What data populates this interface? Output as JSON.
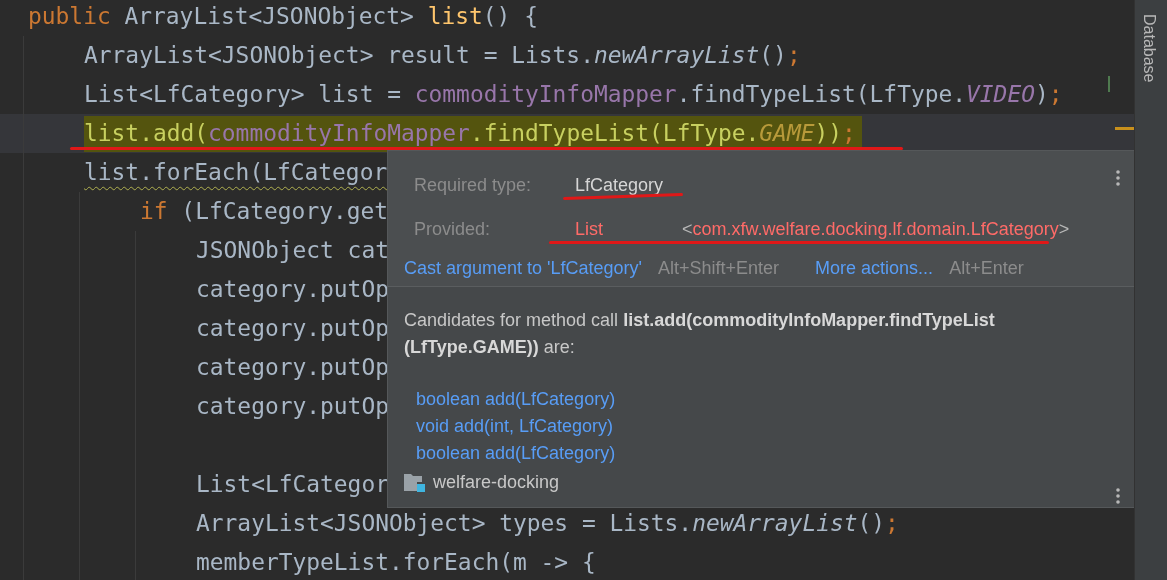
{
  "editor": {
    "lines": [
      {
        "kind": "code",
        "current": false,
        "marked": false,
        "warning": false,
        "tokens": [
          {
            "text": "public ",
            "kind": "keyword"
          },
          {
            "text": "ArrayList<JSONObject> ",
            "kind": "plain"
          },
          {
            "text": "list",
            "kind": "method-decl"
          },
          {
            "text": "() {",
            "kind": "plain"
          }
        ],
        "children": [
          {
            "kind": "code",
            "current": false,
            "marked": false,
            "warning": false,
            "tokens": [
              {
                "text": "ArrayList<JSONObject> result = Lists.",
                "kind": "plain"
              },
              {
                "text": "newArrayList",
                "kind": "static-method"
              },
              {
                "text": "()",
                "kind": "plain"
              },
              {
                "text": ";",
                "kind": "semicolon"
              }
            ]
          },
          {
            "kind": "code",
            "current": false,
            "marked": false,
            "warning": false,
            "tokens": [
              {
                "text": "List<LfCategory> list = ",
                "kind": "plain"
              },
              {
                "text": "commodityInfoMapper",
                "kind": "field"
              },
              {
                "text": ".findTypeList(LfType.",
                "kind": "plain"
              },
              {
                "text": "VIDEO",
                "kind": "constant"
              },
              {
                "text": ")",
                "kind": "plain"
              },
              {
                "text": ";",
                "kind": "semicolon"
              }
            ]
          },
          {
            "kind": "code",
            "current": true,
            "marked": true,
            "warning": false,
            "tokens": [
              {
                "text": "list.add(",
                "kind": "plain"
              },
              {
                "text": "commodityInfoMapper",
                "kind": "field"
              },
              {
                "text": ".findTypeList(LfType.",
                "kind": "plain"
              },
              {
                "text": "GAME",
                "kind": "constant"
              },
              {
                "text": "))",
                "kind": "plain"
              },
              {
                "text": ";",
                "kind": "semicolon"
              }
            ]
          },
          {
            "kind": "code",
            "current": false,
            "marked": false,
            "warning": true,
            "tokens": [
              {
                "text": "list.forEach(LfCategor",
                "kind": "plain"
              }
            ],
            "children": [
              {
                "kind": "code",
                "current": false,
                "marked": false,
                "warning": false,
                "tokens": [
                  {
                    "text": "if ",
                    "kind": "keyword"
                  },
                  {
                    "text": "(LfCategory.get",
                    "kind": "plain"
                  }
                ],
                "children": [
                  {
                    "kind": "code",
                    "current": false,
                    "marked": false,
                    "warning": false,
                    "tokens": [
                      {
                        "text": "JSONObject cat",
                        "kind": "plain"
                      }
                    ]
                  },
                  {
                    "kind": "code",
                    "current": false,
                    "marked": false,
                    "warning": false,
                    "tokens": [
                      {
                        "text": "category.putOp",
                        "kind": "plain"
                      }
                    ]
                  },
                  {
                    "kind": "code",
                    "current": false,
                    "marked": false,
                    "warning": false,
                    "tokens": [
                      {
                        "text": "category.putOp",
                        "kind": "plain"
                      }
                    ]
                  },
                  {
                    "kind": "code",
                    "current": false,
                    "marked": false,
                    "warning": false,
                    "tokens": [
                      {
                        "text": "category.putOp",
                        "kind": "plain"
                      }
                    ]
                  },
                  {
                    "kind": "code",
                    "current": false,
                    "marked": false,
                    "warning": false,
                    "tokens": [
                      {
                        "text": "category.putOp",
                        "kind": "plain"
                      }
                    ]
                  },
                  {
                    "kind": "blank",
                    "current": false,
                    "marked": false
                  },
                  {
                    "kind": "code",
                    "current": false,
                    "marked": false,
                    "warning": false,
                    "tokens": [
                      {
                        "text": "List<LfCategor",
                        "kind": "plain"
                      }
                    ]
                  },
                  {
                    "kind": "code",
                    "current": false,
                    "marked": false,
                    "warning": false,
                    "tokens": [
                      {
                        "text": "ArrayList<JSONObject> types = Lists.",
                        "kind": "plain"
                      },
                      {
                        "text": "newArrayList",
                        "kind": "static-method"
                      },
                      {
                        "text": "()",
                        "kind": "plain"
                      },
                      {
                        "text": ";",
                        "kind": "semicolon"
                      }
                    ]
                  },
                  {
                    "kind": "code",
                    "current": false,
                    "marked": false,
                    "warning": false,
                    "tokens": [
                      {
                        "text": "memberTypeList.forEach(m -> {",
                        "kind": "plain"
                      }
                    ]
                  }
                ]
              }
            ]
          }
        ]
      }
    ]
  },
  "popup": {
    "required_label": "Required type:",
    "required_value": "LfCategory",
    "required_annotated": true,
    "provided_label": "Provided:",
    "provided_parts": [
      {
        "text": "List",
        "kind": "type"
      },
      {
        "text": "<",
        "kind": "bracket"
      },
      {
        "text": "com.xfw.welfare.docking.lf.domain.LfCategory",
        "kind": "type"
      },
      {
        "text": ">",
        "kind": "bracket"
      }
    ],
    "provided_annotated": true,
    "actions": [
      {
        "label": "Cast argument to 'LfCategory'",
        "shortcut": "Alt+Shift+Enter"
      },
      {
        "label": "More actions...",
        "shortcut": "Alt+Enter"
      }
    ],
    "message": "Candidates for method call **list.add(commodityInfoMapper.findTypeList (LfType.GAME))** are:",
    "candidates": [
      "boolean add(LfCategory)",
      "void add(int, LfCategory)",
      "boolean add(LfCategory)"
    ],
    "module": "welfare-docking"
  },
  "side_panel": {
    "tab": "Database"
  }
}
